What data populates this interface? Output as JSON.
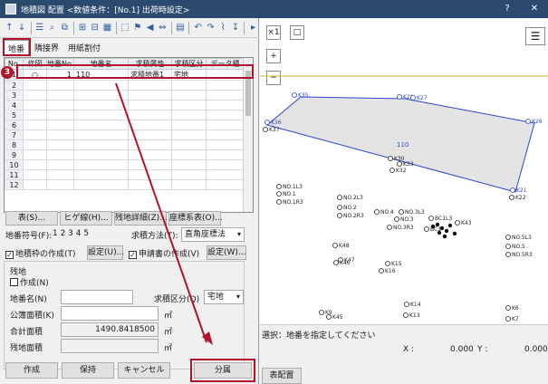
{
  "window": {
    "title": "地積図 配置 <数値条件：[No.1] 出荷時設定>",
    "help": "?",
    "close": "✕"
  },
  "tabs": [
    "地番",
    "隣接界",
    "用紙割付"
  ],
  "grid": {
    "columns": [
      "No.",
      "作図",
      "地番No.",
      "地番名",
      "求積属性",
      "求積区分",
      "データ種"
    ],
    "rows": [
      {
        "no": "1",
        "draw": "○",
        "lot_no": "1",
        "name": "110",
        "attr": "求積地番1",
        "kubun": "宅地",
        "type": ""
      },
      {
        "no": "2"
      },
      {
        "no": "3"
      },
      {
        "no": "4"
      },
      {
        "no": "5"
      },
      {
        "no": "6"
      },
      {
        "no": "7"
      },
      {
        "no": "8"
      },
      {
        "no": "9"
      },
      {
        "no": "10"
      },
      {
        "no": "11"
      },
      {
        "no": "12"
      }
    ]
  },
  "badge_step": "3",
  "buttons": {
    "table": "表(S)...",
    "hige": "ヒゲ線(H)...",
    "detail": "残地詳細(Z)...",
    "coords": "座標系表(O)...",
    "settings1": "設定(U)...",
    "settings2": "設定(W)...",
    "create": "作成",
    "save": "保持",
    "cancel": "キャンセル",
    "split": "分属",
    "table_place": "表配置"
  },
  "form": {
    "symbol_label": "地番符号(F):",
    "symbol_value": "1 2 3 4 5",
    "method_label": "求積方法(T):",
    "method_value": "直角座標法",
    "create_frame_label": "地積枠の作成(T)",
    "create_doc_label": "申請書の作成(V)",
    "remainder_group": "残地",
    "create_label": "作成(N)",
    "lot_name_label": "地番名(N)",
    "kubun_label": "求積区分(Q)",
    "kubun_value": "宅地",
    "public_area_label": "公簿面積(K)",
    "total_area_label": "合計面積",
    "total_area_value": "1490.8418500",
    "remainder_area_label": "残地面積",
    "unit": "㎡"
  },
  "map": {
    "zoom_buttons": [
      "×1",
      "□",
      "+",
      "−"
    ],
    "status_text": "選択：地番を指定してください",
    "x_label": "X :",
    "x_value": "0.000",
    "y_label": "Y :",
    "y_value": "0.000",
    "lot_label": "110",
    "lot_label2": "K29",
    "points": [
      "K35",
      "K28",
      "K27",
      "K36",
      "K37",
      "K26",
      "K30",
      "K32",
      "K33",
      "K21",
      "K22",
      "NO.1L3",
      "NO.1",
      "NO.1R3",
      "NO.2L3",
      "NO.2",
      "NO.2R3",
      "NO.4",
      "NO.3L3",
      "NO.3",
      "NO.3R3",
      "BC1L3",
      "BC1",
      "K43",
      "K48",
      "K47",
      "K46",
      "K15",
      "K16",
      "NO.5L3",
      "NO.5",
      "NO.5R3",
      "K14",
      "K13",
      "K6",
      "K7",
      "K45",
      "K9"
    ],
    "polygon_color": "#2c44d4"
  },
  "colors": {
    "title_bar": "#2b4a6e",
    "highlight": "#b0132b",
    "accent_line": "#c9b829"
  }
}
